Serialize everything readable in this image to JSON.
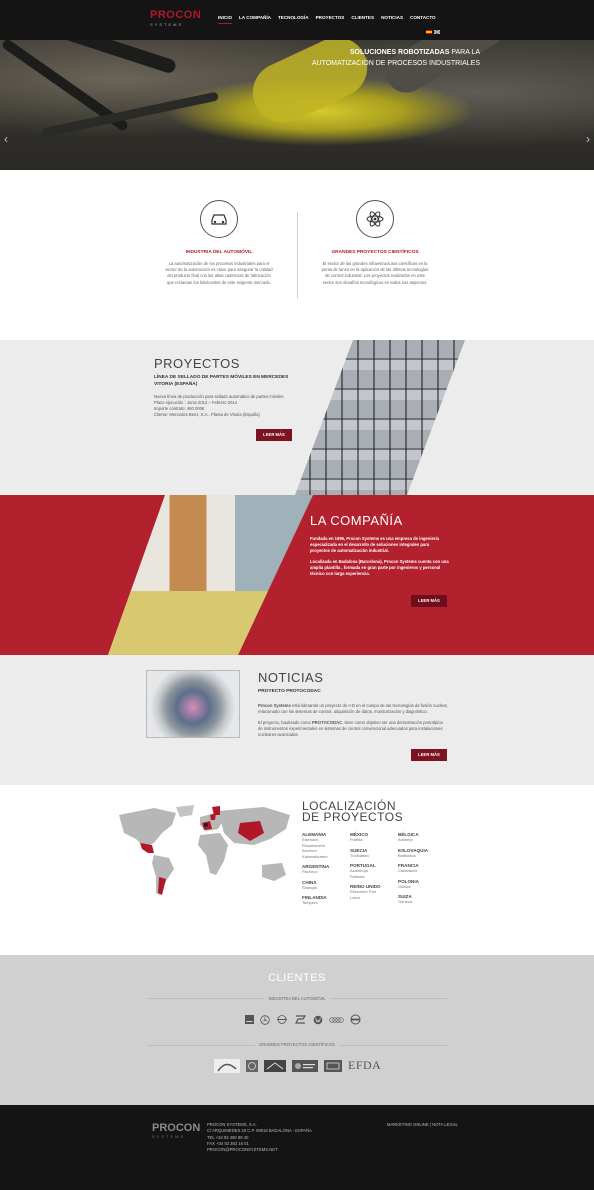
{
  "header": {
    "logo_word": "PROCON",
    "logo_sub": "SYSTEMS",
    "nav": [
      {
        "label": "INICIO",
        "active": true
      },
      {
        "label": "LA COMPAÑÍA"
      },
      {
        "label": "TECNOLOGÍA"
      },
      {
        "label": "PROYECTOS"
      },
      {
        "label": "CLIENTES"
      },
      {
        "label": "NOTICIAS"
      },
      {
        "label": "CONTACTO"
      }
    ],
    "languages": [
      "es",
      "en"
    ]
  },
  "hero": {
    "title_bold": "SOLUCIONES ROBOTIZADAS",
    "title_rest": " PARA LA AUTOMATIZACIÓN DE PROCESOS INDUSTRIALES",
    "prev_arrow": "‹",
    "next_arrow": "›"
  },
  "services": [
    {
      "icon": "car-icon",
      "title": "INDUSTRIA DEL AUTOMÓVIL",
      "body": "La automatización de los procesos industriales para el sector de la automoción es clave para asegurar la calidad del producto final con las altas cadencias de fabricación que reclaman los fabricantes de este exigente mercado."
    },
    {
      "icon": "atom-icon",
      "title": "GRANDES PROYECTOS CIENTÍFICOS",
      "body": "El sector de las grandes infraestructuras científicas es la punta de lanza en la aplicación de las últimas tecnologías de control industrial. Los proyectos realizados en este sector son desafíos tecnológicos en todos sus aspectos."
    }
  ],
  "proyectos": {
    "title": "PROYECTOS",
    "subtitle": "LÍNEA DE SELLADO DE PARTES MÓVILES EN MERCEDES VITORIA (ESPAÑA)",
    "lines": [
      "Nueva línea de producción para sellado automático de partes móviles",
      "Plazo ejecución : Junio 2012 – Febrero 2014",
      "Importe contrato: 460.000€",
      "Cliente: Mercedes Benz, S.A., Planta de Vitoria (España)"
    ],
    "button": "LEER MÁS"
  },
  "compania": {
    "title": "LA COMPAÑÍA",
    "para1": "Fundada en 1995, Procon Systems es una empresa de ingeniería especializada en el desarrollo de soluciones integrales para proyectos de automatización industrial.",
    "para2": "Localizada en Badalona (Barcelona), Procon Systems cuenta con una amplia plantilla , formada en gran parte por ingenieros y personal técnico con larga experiencia.",
    "button": "LEER MÁS"
  },
  "noticias": {
    "title": "NOTICIAS",
    "subtitle": "PROYECTO PROTOCODAC",
    "para1_bold": "Procon Systems",
    "para1": " está liderando un proyecto de I+D en el campo de las tecnologías de fusión nuclear, relacionado con los sistemas de control, adquisición de datos, monitorización y diagnóstico.",
    "para2_a": "El proyecto, bautizado como ",
    "para2_bold": "PROTOCODAC",
    "para2_b": ", tiene como objetivo ser una demostración prototípica de instrumentos experimentales en sistemas de control convencional adecuados para instalaciones nucleares avanzadas.",
    "button": "LEER MÁS"
  },
  "localizacion": {
    "title_line1": "LOCALIZACIÓN",
    "title_line2": "DE PROYECTOS",
    "columns": [
      [
        {
          "country": "ALEMANIA",
          "cities": [
            "Eisenach",
            "Rüsselsheim",
            "Bochum",
            "Kaiserslautern"
          ]
        },
        {
          "country": "ARGENTINA",
          "cities": [
            "Pacheco"
          ]
        },
        {
          "country": "CHINA",
          "cities": [
            "Shangai"
          ]
        },
        {
          "country": "FINLANDIA",
          "cities": [
            "Tampere"
          ]
        }
      ],
      [
        {
          "country": "MÉXICO",
          "cities": [
            "Puebla"
          ]
        },
        {
          "country": "SUECIA",
          "cities": [
            "Trollhättan"
          ]
        },
        {
          "country": "PORTUGAL",
          "cities": [
            "Azambuja",
            "Palmela"
          ]
        },
        {
          "country": "REINO UNIDO",
          "cities": [
            "Ellesmere Port",
            "Luton"
          ]
        }
      ],
      [
        {
          "country": "BÉLGICA",
          "cities": [
            "Antwerp"
          ]
        },
        {
          "country": "ESLOVAQUIA",
          "cities": [
            "Bratislava"
          ]
        },
        {
          "country": "FRANCIA",
          "cities": [
            "Cadarache"
          ]
        },
        {
          "country": "POLONIA",
          "cities": [
            "Gliwice"
          ]
        },
        {
          "country": "SUIZA",
          "cities": [
            "Geneva"
          ]
        }
      ]
    ]
  },
  "clientes": {
    "title": "CLIENTES",
    "cat1": "INDUSTRIA DEL AUTOMÓVIL",
    "cat2": "GRANDES PROYECTOS CIENTÍFICOS",
    "auto_logos": [
      "GM",
      "Mercedes",
      "Opel",
      "Seat",
      "VW",
      "Audi",
      "Volvo"
    ],
    "sci_logos": [
      "iter",
      "CERN",
      "ALBA",
      "Fusion for Energy",
      "CIEMAT",
      "EFDA"
    ],
    "efda_text": "EFDA"
  },
  "footer": {
    "logo_word": "PROCON",
    "logo_sub": "SYSTEMS",
    "address": [
      "PROCON SYSTEMS, S.A.",
      "C/ ARQUIMEDES 26 C.P. 08918 BADALONA - ESPAÑA",
      "TEL +34 93 460 89 40",
      "FAX +34 93 383 16 01",
      "PROCON@PROCONSYSTEMS.NET"
    ],
    "links": "MARKETING ONLINE | NOTA LEGAL"
  },
  "colors": {
    "brand_red": "#b0182a",
    "dark": "#141414",
    "button": "#7d1220"
  }
}
